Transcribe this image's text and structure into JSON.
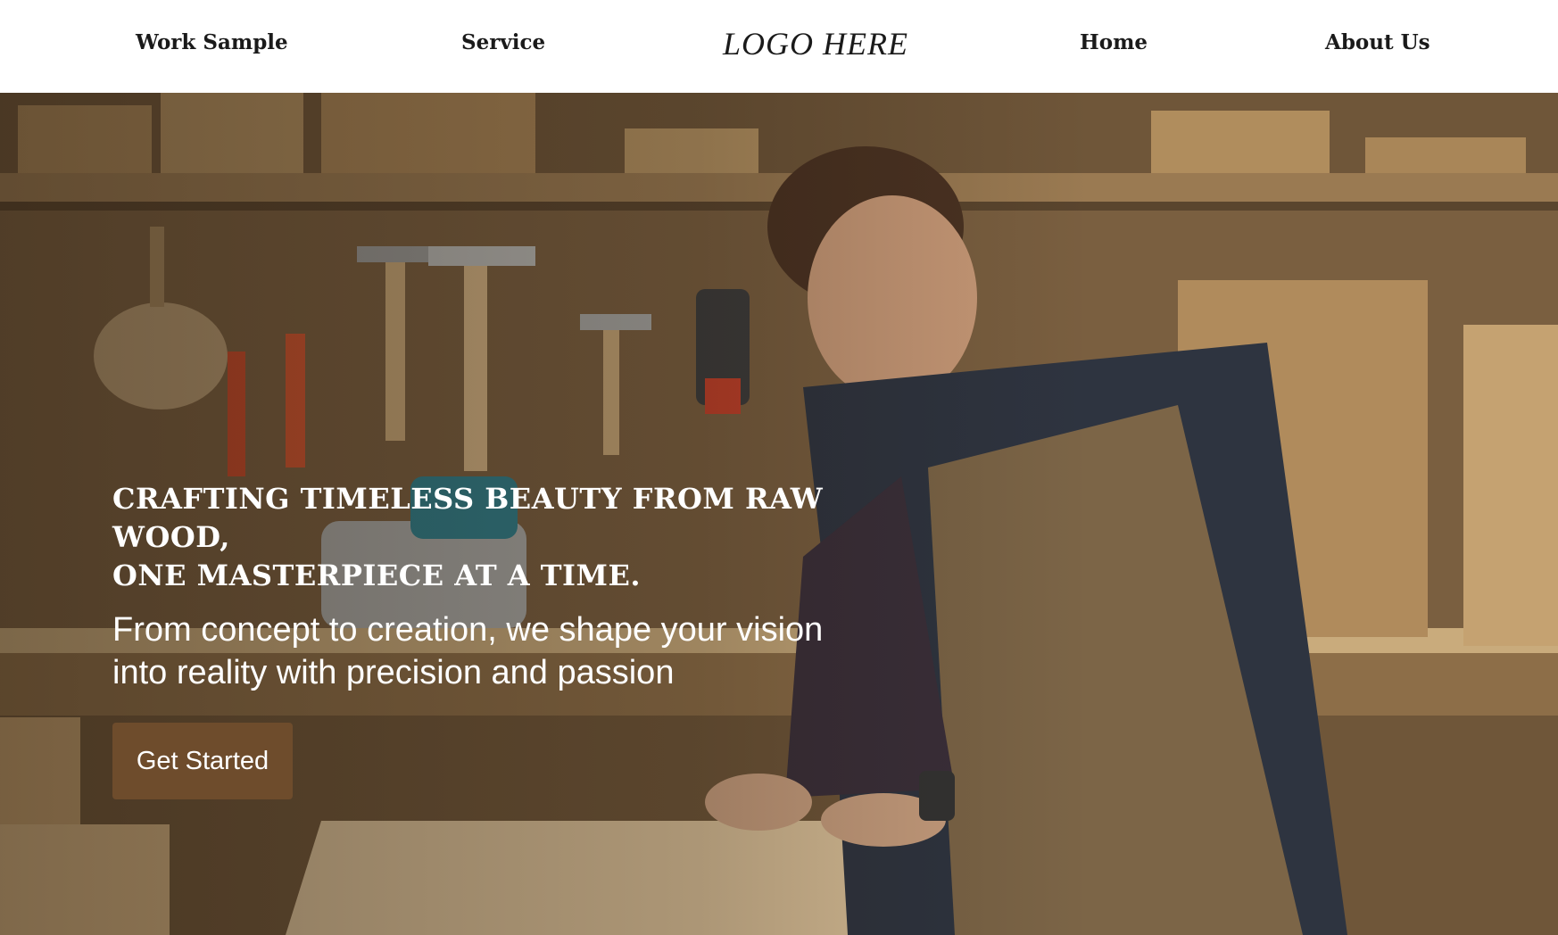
{
  "nav": {
    "links": [
      {
        "label": "Work Sample"
      },
      {
        "label": "Service"
      },
      {
        "label": "Home"
      },
      {
        "label": "About Us"
      }
    ],
    "logo": "LOGO HERE"
  },
  "hero": {
    "headline_lines": [
      "CRAFTING TIMELESS BEAUTY FROM RAW WOOD,",
      "ONE MASTERPIECE AT A TIME."
    ],
    "subtext_lines": [
      "From concept to creation, we shape your vision",
      "into reality with precision and passion"
    ],
    "cta_label": "Get Started",
    "image_icon": "woodworker-photo"
  },
  "colors": {
    "cta_background": "#6e4c2c",
    "nav_background": "#ffffff",
    "text_dark": "#1a1a1a",
    "text_light": "#ffffff"
  }
}
